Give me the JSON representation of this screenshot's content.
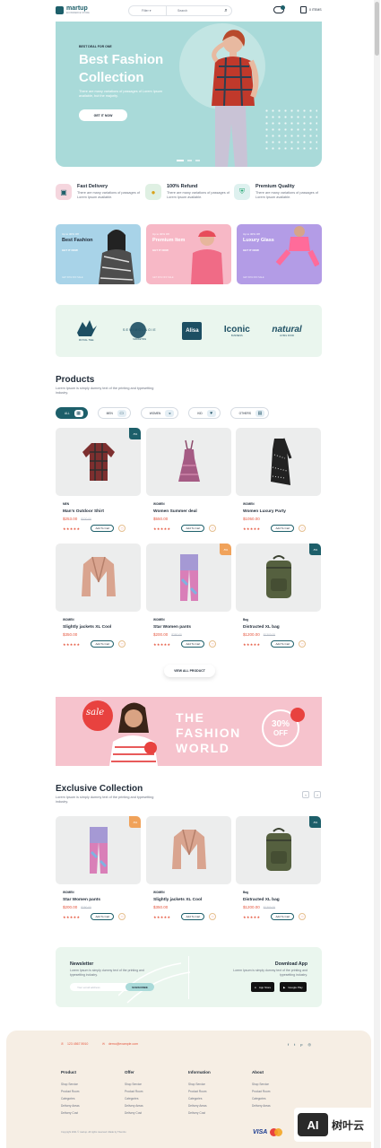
{
  "header": {
    "logo": "martup",
    "logo_tagline": "ECOMMERCE STORE",
    "search_category": "Filter",
    "search_placeholder": "Search",
    "cart_label": "0 ITEMS"
  },
  "hero": {
    "eyebrow": "BEST DEAL FOR ONE",
    "title": "Best Fashion Collection",
    "description": "There are many variations of passages of Lorem Ipsum available, but the majority.",
    "button": "GET IT NOW"
  },
  "features": [
    {
      "title": "Fast Delivery",
      "desc": "There are many variations of passages of Lorem Ipsum available.",
      "icon": "truck-icon",
      "color": "#f5d6de"
    },
    {
      "title": "100% Refund",
      "desc": "There are many variations of passages of Lorem Ipsum available.",
      "icon": "coin-icon",
      "color": "#dff0e3"
    },
    {
      "title": "Premium Quality",
      "desc": "There are many variations of passages of Lorem Ipsum available.",
      "icon": "shield-icon",
      "color": "#def1ef"
    }
  ],
  "promos": [
    {
      "eyebrow": "Up to 30% Off",
      "title": "Best Fashion",
      "button": "GET IT NOW",
      "footer": "GET 30% OFF SALE",
      "color": "#a8d3e8"
    },
    {
      "eyebrow": "Up to 30% Off",
      "title": "Premium Item",
      "button": "GET IT NOW",
      "footer": "GET 30% OFF SALE",
      "color": "#f7b8c6"
    },
    {
      "eyebrow": "Up to 30% Off",
      "title": "Luxury Glass",
      "button": "GET IT NOW",
      "footer": "GET 30% OFF SALE",
      "color": "#b39ce6"
    }
  ],
  "brands": [
    {
      "name": "ROYAL TEE",
      "sub": ""
    },
    {
      "name": "SEMIMOLNOIE",
      "sub": "MARKETING"
    },
    {
      "name": "Alisa",
      "sub": ""
    },
    {
      "name": "Iconic",
      "sub": "BUSINESS"
    },
    {
      "name": "natural",
      "sub": "LIVING FOOD"
    }
  ],
  "products_section": {
    "title": "Products",
    "desc": "Lorem Ipsum is simply dummy text of the printing and typesetting industry.",
    "filters": [
      "ALL",
      "MEN",
      "WOMEN",
      "KID",
      "OTHERS"
    ],
    "view_all": "VIEW ALL PRODUCT"
  },
  "products": [
    {
      "cat": "MEN",
      "name": "Man's Outdoor Shirt",
      "price": "$253.00",
      "old": "$320.00",
      "badge": "-5%",
      "badge_color": "#1d5f6a"
    },
    {
      "cat": "WOMEN",
      "name": "Women Summer deal",
      "price": "$550.00",
      "old": "",
      "badge": "",
      "badge_color": ""
    },
    {
      "cat": "WOMEN",
      "name": "Women Luxury Party",
      "price": "$1050.00",
      "old": "",
      "badge": "",
      "badge_color": ""
    },
    {
      "cat": "WOMEN",
      "name": "Slightly jackets XL Cool",
      "price": "$350.00",
      "old": "",
      "badge": "",
      "badge_color": ""
    },
    {
      "cat": "WOMEN",
      "name": "Star Women pants",
      "price": "$200.00",
      "old": "$250.00",
      "badge": "-5%",
      "badge_color": "#f0a25a"
    },
    {
      "cat": "Bag",
      "name": "Distracted XL bag",
      "price": "$1200.00",
      "old": "$1300.00",
      "badge": "-5%",
      "badge_color": "#1d5f6a"
    }
  ],
  "add_to_cart": "Add To Cart",
  "fashion_banner": {
    "script": "sale",
    "title_line1": "THE",
    "title_line2": "FASHION",
    "title_line3": "WORLD",
    "discount": "30%",
    "discount_label": "OFF"
  },
  "exclusive": {
    "title": "Exclusive Collection",
    "desc": "Lorem Ipsum is simply dummy text of the printing and typesetting industry.",
    "products": [
      {
        "cat": "WOMEN",
        "name": "Star Women pants",
        "price": "$200.00",
        "old": "$250.00",
        "badge": "-5%",
        "badge_color": "#f0a25a"
      },
      {
        "cat": "WOMEN",
        "name": "Slightly jackets XL Cool",
        "price": "$350.00",
        "old": "",
        "badge": "",
        "badge_color": ""
      },
      {
        "cat": "Bag",
        "name": "Distracted XL bag",
        "price": "$1200.00",
        "old": "$1300.00",
        "badge": "-5%",
        "badge_color": "#1d5f6a"
      }
    ]
  },
  "newsletter": {
    "title": "Newsletter",
    "desc": "Lorem Ipsum is simply dummy text of the printing and typesetting industry.",
    "placeholder": "Your email address",
    "button": "SUBSCRIBE",
    "app_title": "Download App",
    "app_desc": "Lorem Ipsum is simply dummy text of the printing and typesetting industry.",
    "app_store": "App Store",
    "google_play": "Google Play"
  },
  "footer": {
    "phone": "123 4567 8910",
    "email": "demo@example.com",
    "columns": [
      {
        "title": "Product",
        "links": [
          "Shop Service",
          "Product Room",
          "Categories",
          "Delivery Areas",
          "Delivery Cost"
        ]
      },
      {
        "title": "Offer",
        "links": [
          "Shop Service",
          "Product Room",
          "Categories",
          "Delivery Areas",
          "Delivery Cost"
        ]
      },
      {
        "title": "Information",
        "links": [
          "Shop Service",
          "Product Room",
          "Categories",
          "Delivery Areas",
          "Delivery Cost"
        ]
      },
      {
        "title": "About",
        "links": [
          "Shop Service",
          "Product Room",
          "Categories",
          "Delivery Areas"
        ]
      }
    ],
    "copyright": "Copyright 2021 © martup. All rights reserved. Made by Thembo",
    "payments": [
      "VISA",
      "Mastercard",
      "PayPal"
    ]
  },
  "watermark": {
    "mark": "AI",
    "text": "树叶云"
  }
}
